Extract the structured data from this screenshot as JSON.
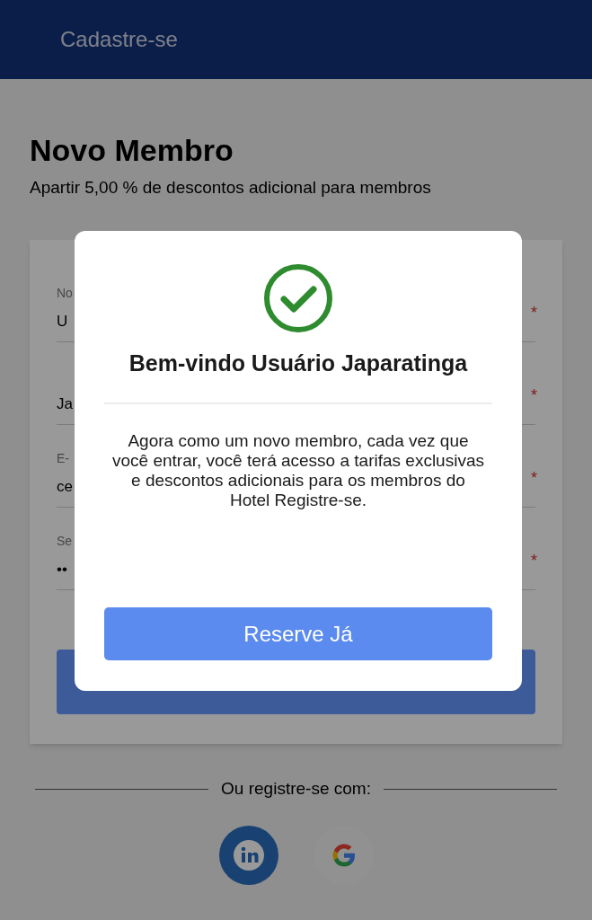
{
  "header": {
    "title": "Cadastre-se"
  },
  "intro": {
    "title": "Novo Membro",
    "subtitle": "Apartir 5,00 % de descontos adicional para membros"
  },
  "form": {
    "fields": [
      {
        "label": "No",
        "value": "U",
        "required_mark": "*"
      },
      {
        "value": "Ja",
        "required_mark": "*"
      },
      {
        "label": "E-",
        "value": "ce",
        "required_mark": "*"
      },
      {
        "label": "Se",
        "value": "••",
        "required_mark": "*"
      }
    ]
  },
  "social": {
    "caption": "Ou registre-se com:",
    "providers": [
      {
        "kind": "linkedin"
      },
      {
        "kind": "google"
      }
    ]
  },
  "modal": {
    "title": "Bem-vindo Usuário Japaratinga",
    "message": "Agora como um novo membro, cada vez que você entrar, você terá acesso a tarifas exclusivas e descontos adicionais para os membros do Hotel Registre-se.",
    "button": "Reserve Já"
  }
}
